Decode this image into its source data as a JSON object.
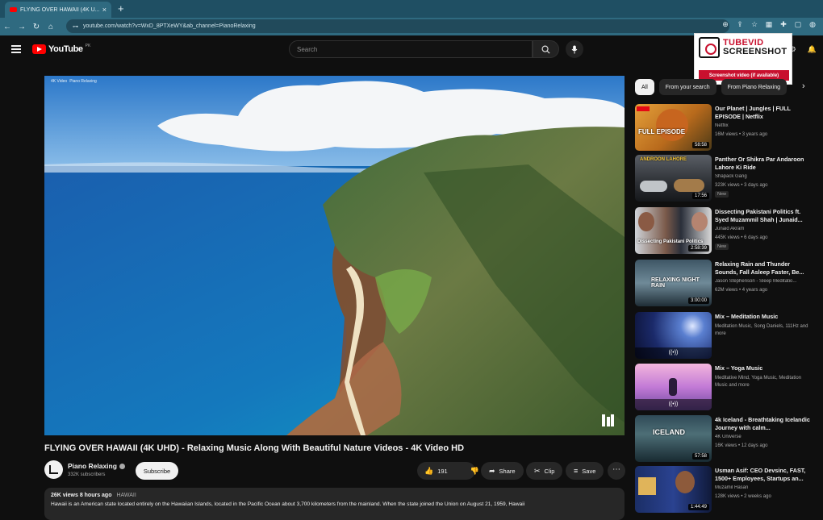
{
  "browser": {
    "tab_title": "FLYING OVER HAWAII (4K U...",
    "tab_close": "×",
    "new_tab": "+",
    "url": "youtube.com/watch?v=WxD_8PTXeWY&ab_channel=PianoRelaxing",
    "nav": {
      "back": "←",
      "forward": "→",
      "reload": "↻",
      "home": "⌂"
    },
    "extensions": [
      "⊕",
      "⇪",
      "☆",
      "▦",
      "✚",
      "▢",
      "◍"
    ]
  },
  "header": {
    "logo_text": "YouTube",
    "country_code": "PK",
    "search_placeholder": "Search",
    "search_icon": "⌕",
    "mic_icon": "🎤",
    "right_icons": [
      "⚙",
      "🔔"
    ]
  },
  "tubevid": {
    "brand_line1": "TUBEVID",
    "brand_line2": "SCREENSHOT",
    "capture_button": "Screenshot video (if available)"
  },
  "player": {
    "overlay_channel": "4K Video",
    "overlay_sub": "Piano Relaxing"
  },
  "video": {
    "title": "FLYING OVER HAWAII (4K UHD) - Relaxing Music Along With Beautiful Nature Videos - 4K Video HD",
    "channel_name": "Piano Relaxing",
    "channel_subs": "332K subscribers",
    "subscribe_label": "Subscribe",
    "likes": "191",
    "share_label": "Share",
    "clip_label": "Clip",
    "save_label": "Save",
    "more_label": "⋯",
    "views": "26K views",
    "posted": "8 hours ago",
    "hashtag": "HAWAII",
    "description": "Hawaii is an American state located entirely on the Hawaiian Islands, located in the Pacific Ocean about 3,700 kilometers from the mainland. When the state joined the Union on August 21, 1959, Hawaii"
  },
  "chips": [
    "All",
    "From your search",
    "From Piano Relaxing"
  ],
  "recommendations": [
    {
      "title": "Our Planet | Jungles | FULL EPISODE | Netflix",
      "channel": "Netflix",
      "meta": "16M views • 3 years ago",
      "duration": "58:58",
      "badge": "",
      "thumb_text": "FULL EPISODE"
    },
    {
      "title": "Panther Or Shikra Par Andaroon Lahore Ki Ride",
      "channel": "Shapack Gang",
      "meta": "323K views • 3 days ago",
      "duration": "17:56",
      "badge": "New",
      "thumb_text": "ANDROON LAHORE"
    },
    {
      "title": "Dissecting Pakistani Politics ft. Syed Muzammil Shah | Junaid...",
      "channel": "Junaid Akram",
      "meta": "445K views • 6 days ago",
      "duration": "2:58:39",
      "badge": "New",
      "thumb_text": "Dissecting Pakistani Politics"
    },
    {
      "title": "Relaxing Rain and Thunder Sounds, Fall Asleep Faster, Be...",
      "channel": "Jason Stephenson - Sleep Meditatio...",
      "meta": "62M views • 4 years ago",
      "duration": "3:00:00",
      "badge": "",
      "thumb_text": "RELAXING NIGHT RAIN"
    },
    {
      "title": "Mix – Meditation Music",
      "channel": "Meditation Music, Song Daniels, 111Hz and more",
      "meta": "",
      "duration": "",
      "badge": "",
      "thumb_text": ""
    },
    {
      "title": "Mix – Yoga Music",
      "channel": "Meditative Mind, Yoga Music, Meditation Music and more",
      "meta": "",
      "duration": "",
      "badge": "",
      "thumb_text": ""
    },
    {
      "title": "4k Iceland - Breathtaking Icelandic Journey with calm...",
      "channel": "4K Universe",
      "meta": "16K views • 12 days ago",
      "duration": "57:58",
      "badge": "",
      "thumb_text": "ICELAND"
    },
    {
      "title": "Usman Asif: CEO Devsinc, FAST, 1500+ Employees, Startups an...",
      "channel": "Muzamil Hasan",
      "meta": "128K views • 2 weeks ago",
      "duration": "1:44:49",
      "badge": "",
      "thumb_text": ""
    }
  ],
  "colors": {
    "page_bg": "#0f0f0f",
    "chrome": "#2f6a80",
    "brand_red": "#ff0000",
    "tubevid_red": "#c8102e"
  }
}
